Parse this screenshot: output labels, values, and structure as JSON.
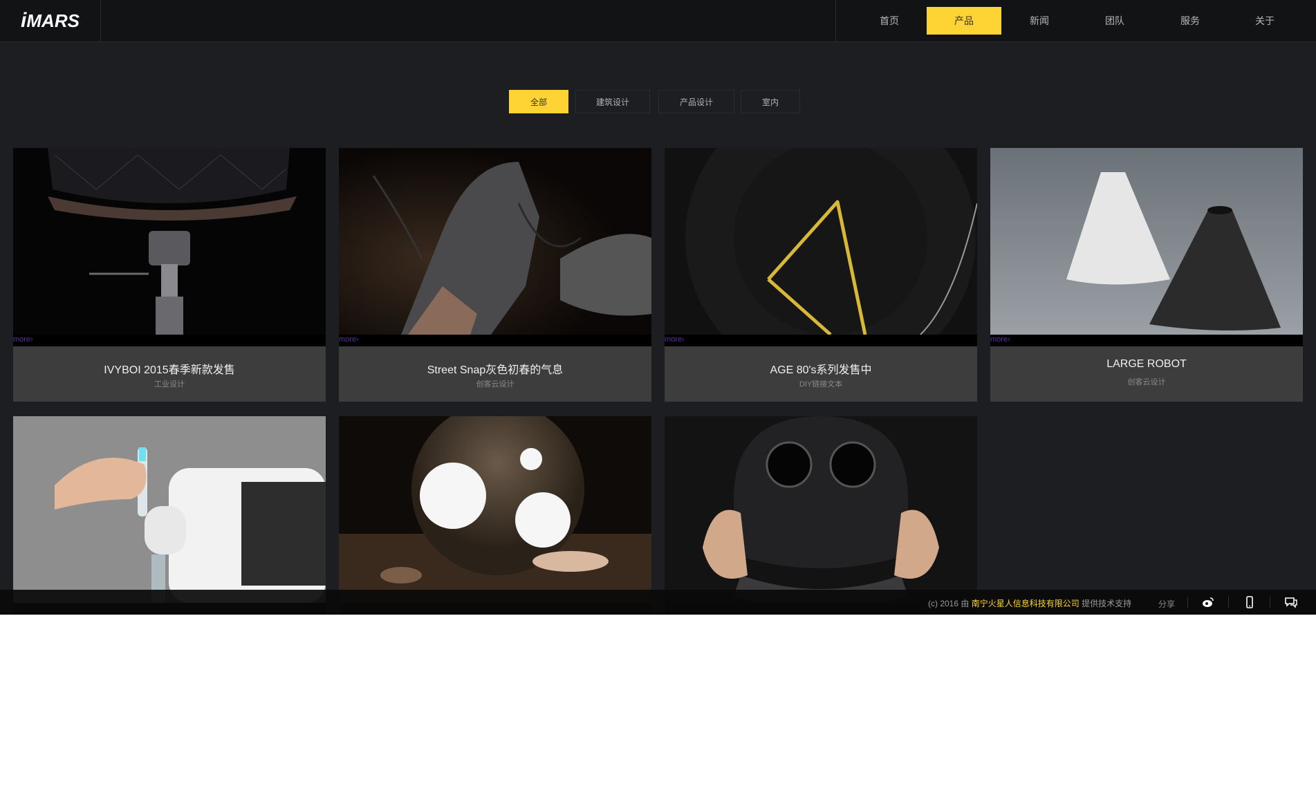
{
  "header": {
    "logo": {
      "i": "i",
      "text": "MARS"
    },
    "nav": [
      "首页",
      "产品",
      "新闻",
      "团队",
      "服务",
      "关于"
    ],
    "active_nav": "产品"
  },
  "filters": {
    "items": [
      "全部",
      "建筑设计",
      "产品设计",
      "室内"
    ],
    "active": "全部"
  },
  "cards": [
    {
      "title": "IVYBOI 2015春季新款发售",
      "sub": "工业设计",
      "more": "more›"
    },
    {
      "title": "Street Snap灰色初春的气息",
      "sub": "创客云设计",
      "more": "more›"
    },
    {
      "title": "AGE 80's系列发售中",
      "sub": "DIY链接文本",
      "more": "more›"
    },
    {
      "title": "LARGE ROBOT",
      "sub": "创客云设计",
      "more": "more›"
    },
    {
      "title": "",
      "sub": "",
      "more": ""
    },
    {
      "title": "",
      "sub": "",
      "more": ""
    },
    {
      "title": "",
      "sub": "",
      "more": ""
    }
  ],
  "footer": {
    "copyright_prefix": "(c) 2016 由",
    "company": "南宁火星人信息科技有限公司",
    "copyright_suffix": "提供技术支持",
    "share": "分享",
    "icons": [
      "weibo-icon",
      "mobile-icon",
      "chat-icon"
    ]
  },
  "colors": {
    "accent": "#fdd433",
    "background": "#1d1e21",
    "header": "#121315",
    "card": "#3d3d3d",
    "more_link": "#5a2ea6"
  }
}
